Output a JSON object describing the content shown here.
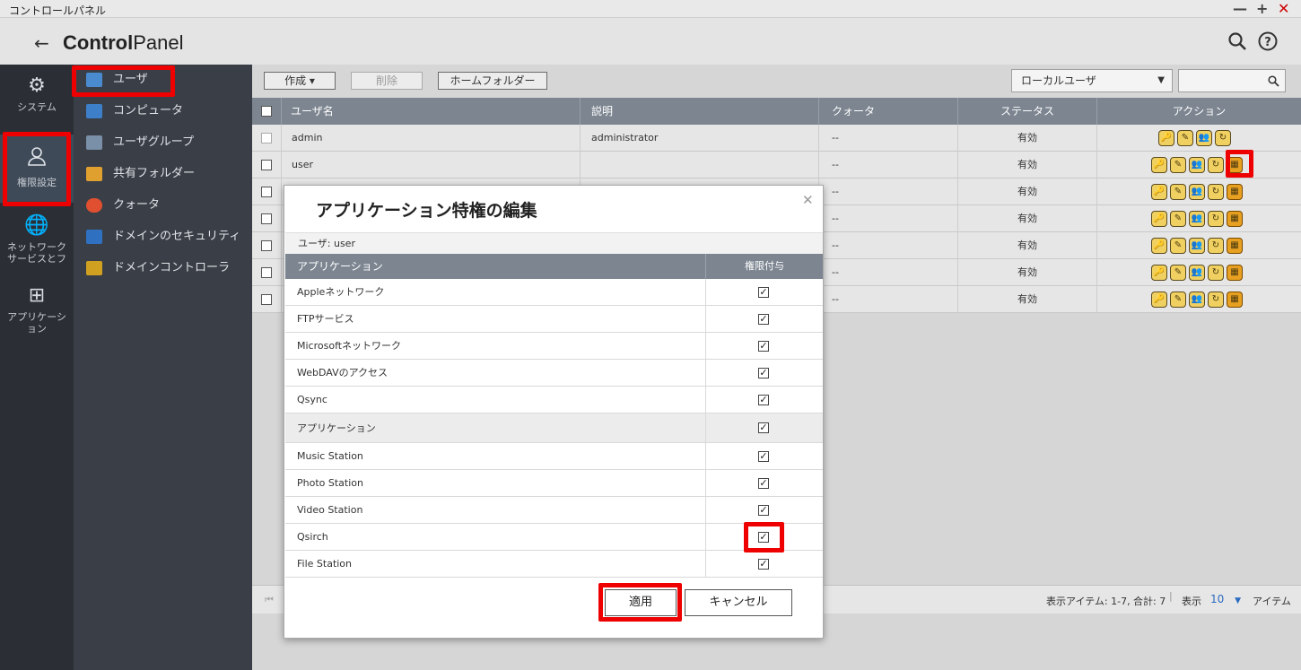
{
  "window": {
    "title": "コントロールパネル"
  },
  "header": {
    "title_bold": "Control",
    "title_light": "Panel"
  },
  "rail": [
    {
      "label": "システム",
      "icon": "gear-icon"
    },
    {
      "label": "権限設定",
      "icon": "user-icon"
    },
    {
      "label": "ネットワーク サービスとフ",
      "icon": "globe-icon"
    },
    {
      "label": "アプリケーシ ョン",
      "icon": "apps-icon"
    }
  ],
  "menu": [
    {
      "label": "ユーザ",
      "color": "#4a8bd0"
    },
    {
      "label": "コンピュータ",
      "color": "#3d7fc8"
    },
    {
      "label": "ユーザグループ",
      "color": "#7a8fa8"
    },
    {
      "label": "共有フォルダー",
      "color": "#e0a030"
    },
    {
      "label": "クォータ",
      "color": "#e05030"
    },
    {
      "label": "ドメインのセキュリティ",
      "color": "#3070c0"
    },
    {
      "label": "ドメインコントローラ",
      "color": "#d0a020"
    }
  ],
  "toolbar": {
    "create": "作成",
    "delete": "削除",
    "home_folder": "ホームフォルダー",
    "user_type": "ローカルユーザ"
  },
  "grid": {
    "headers": [
      "ユーザ名",
      "説明",
      "クォータ",
      "ステータス",
      "アクション"
    ],
    "rows": [
      {
        "name": "admin",
        "desc": "administrator",
        "quota": "--",
        "status": "有効"
      },
      {
        "name": "user",
        "desc": "",
        "quota": "--",
        "status": "有効"
      },
      {
        "name": "",
        "desc": "",
        "quota": "--",
        "status": "有効"
      },
      {
        "name": "",
        "desc": "",
        "quota": "--",
        "status": "有効"
      },
      {
        "name": "",
        "desc": "",
        "quota": "--",
        "status": "有効"
      },
      {
        "name": "",
        "desc": "",
        "quota": "--",
        "status": "有効"
      },
      {
        "name": "",
        "desc": "",
        "quota": "--",
        "status": "有効"
      }
    ]
  },
  "pager": {
    "items_text": "表示アイテム: 1-7, 合計: 7",
    "show": "表示",
    "per_page": "10",
    "items": "アイテム"
  },
  "modal": {
    "title": "アプリケーション特権の編集",
    "user_label": "ユーザ: user",
    "col_app": "アプリケーション",
    "col_grant": "権限付与",
    "rows": [
      {
        "label": "Appleネットワーク",
        "checked": true
      },
      {
        "label": "FTPサービス",
        "checked": true
      },
      {
        "label": "Microsoftネットワーク",
        "checked": true
      },
      {
        "label": "WebDAVのアクセス",
        "checked": true
      },
      {
        "label": "Qsync",
        "checked": true
      },
      {
        "label": "アプリケーション",
        "checked": true,
        "group": true
      },
      {
        "label": "Music Station",
        "checked": true
      },
      {
        "label": "Photo Station",
        "checked": true
      },
      {
        "label": "Video Station",
        "checked": true
      },
      {
        "label": "Qsirch",
        "checked": true
      },
      {
        "label": "File Station",
        "checked": true
      }
    ],
    "apply": "適用",
    "cancel": "キャンセル"
  }
}
